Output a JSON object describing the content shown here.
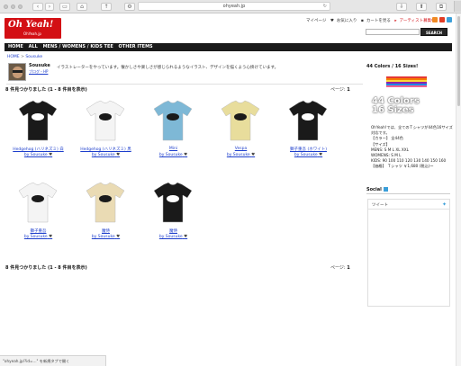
{
  "browser": {
    "url": "ohyeah.jp"
  },
  "header": {
    "logo_text": "Oh Yeah!",
    "logo_sub": "OhYeah.jp",
    "mypage": "マイページ",
    "favorites": "お気に入り",
    "cart": "カートを見る",
    "artist_register": "アーティスト募集中",
    "search_button": "SEARCH"
  },
  "nav": [
    "HOME",
    "ALL",
    "MENS / WOMENS / KIDS TEE",
    "OTHER ITEMS"
  ],
  "breadcrumb": {
    "home": "HOME",
    "separator": ">",
    "current": "Sousuke"
  },
  "seller": {
    "name": "Sousuke",
    "blog_link": "ブログ・HP",
    "description": "イラストレーターをやっています。懐かしさや楽しさが感じられるようなイラスト、デザインを描くよう心掛けています。"
  },
  "results": {
    "count_text": "8 件見つかりました (1 - 8 件目を表示)",
    "page_label": "ページ:",
    "page_number": "1"
  },
  "products": [
    {
      "name": "Hedgehog (ハリネズミ) 白",
      "by": "by Sousuke",
      "color": "#1a1a1a"
    },
    {
      "name": "Hedgehog (ハリネズミ) 黒",
      "by": "by Sousuke",
      "color": "#f4f4f4"
    },
    {
      "name": "Mini",
      "by": "by Sousuke",
      "color": "#7eb8d6"
    },
    {
      "name": "Vespa",
      "by": "by Sousuke",
      "color": "#e8dd9c"
    },
    {
      "name": "獅子重吾 (ホワイト)",
      "by": "by Sousuke",
      "color": "#1a1a1a"
    },
    {
      "name": "獅子重吾",
      "by": "by Sousuke",
      "color": "#f4f4f4"
    },
    {
      "name": "魔侍",
      "by": "by Sousuke",
      "color": "#eadbb4"
    },
    {
      "name": "魔侍",
      "by": "by Sousuke",
      "color": "#1a1a1a"
    }
  ],
  "sidebar": {
    "promo_title": "44 Colors / 16 Sizes!",
    "promo_heading_1": "44 Colors",
    "promo_heading_2": "16 Sizes",
    "promo_lines": [
      "OhYeah!では、全てのＴシャツが44色16サイズ対応です。",
      "【カラー】 全44色",
      "【サイズ】",
      "MENS: S M L XL XXL",
      "WOMENS: S M L",
      "KIDS: 90 100 110 120 130 140 150 160",
      "【価格】 Ｔシャツ ￥1,680 (税込)～"
    ],
    "stripe_colors": [
      "#e53935",
      "#f57c00",
      "#fdd835",
      "#8e24aa",
      "#1e88e5",
      "#f06292"
    ],
    "social_title": "Social",
    "tweet_label": "ツイート"
  },
  "status_bar": "\"ohyeah.jp/?id=...\" を新規タブで開く"
}
